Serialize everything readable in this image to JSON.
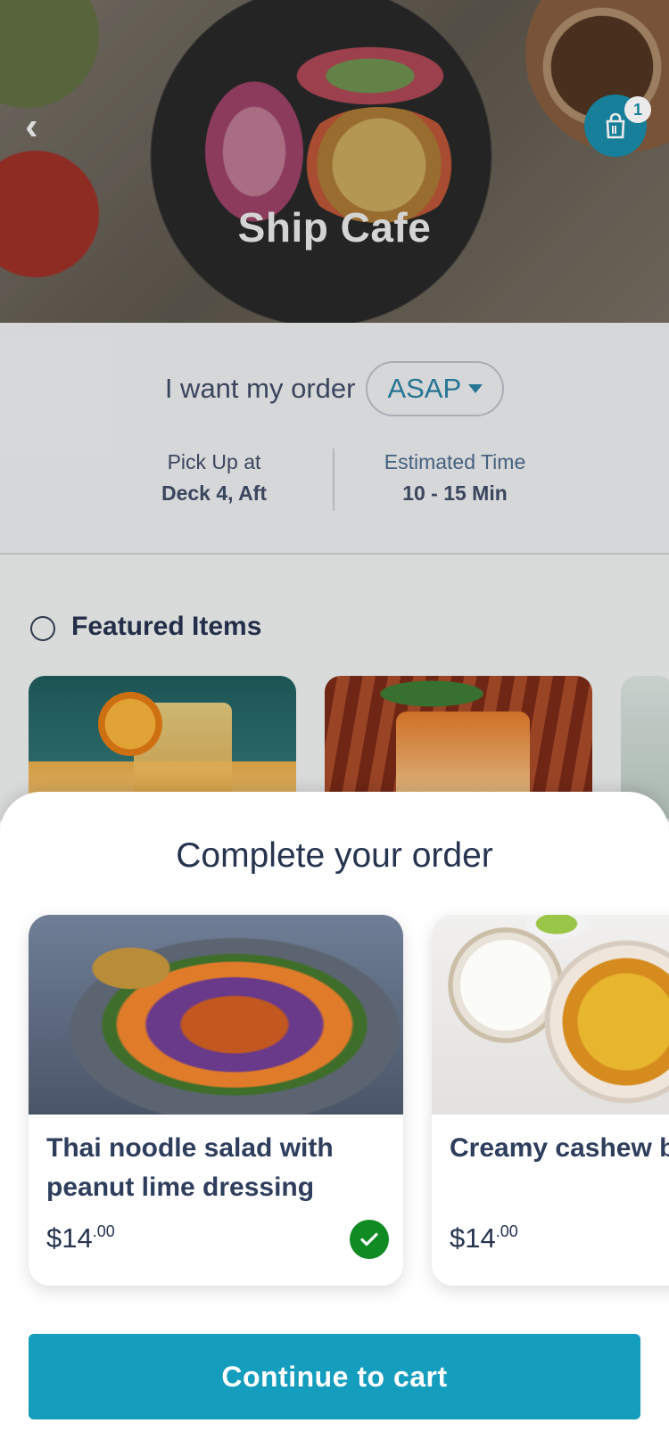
{
  "hero": {
    "title": "Ship Cafe",
    "back_icon": "chevron-left-icon",
    "bag_icon": "bag-icon",
    "bag_count": "1"
  },
  "order": {
    "prefix": "I want my order",
    "timing": "ASAP",
    "pickup_label": "Pick Up at",
    "pickup_value": "Deck 4, Aft",
    "estimate_label": "Estimated Time",
    "estimate_value": "10 - 15 Min"
  },
  "featured": {
    "title": "Featured Items"
  },
  "sheet": {
    "title": "Complete your order",
    "items": [
      {
        "name": "Thai noodle salad with peanut lime dressing",
        "price_dollars": "$14",
        "price_cents": ".00",
        "selected": true
      },
      {
        "name": "Creamy cashew butter paneer",
        "price_dollars": "$14",
        "price_cents": ".00",
        "selected": false
      }
    ],
    "cta_label": "Continue to cart"
  },
  "colors": {
    "accent": "#159dbe",
    "success": "#108a23",
    "text": "#26344f"
  }
}
